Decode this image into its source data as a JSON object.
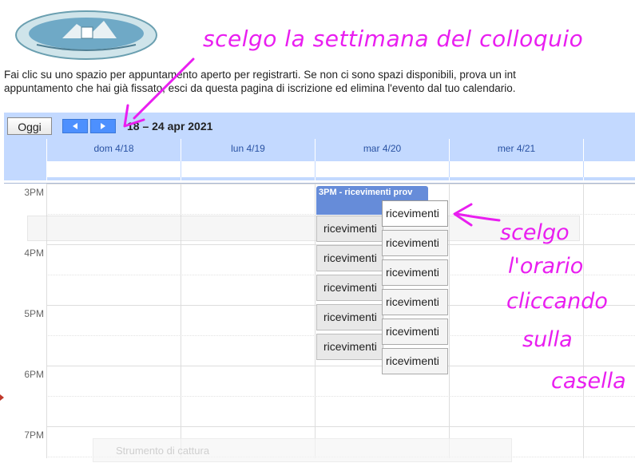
{
  "instructions": {
    "line1": "Fai clic su uno spazio per appuntamento aperto per registrarti. Se non ci sono spazi disponibili, prova un int",
    "line2": "appuntamento che hai già fissato, esci da questa pagina di iscrizione ed elimina l'evento dal tuo calendario."
  },
  "toolbar": {
    "today_label": "Oggi",
    "date_range": "18 – 24 apr 2021"
  },
  "days": [
    "dom 4/18",
    "lun 4/19",
    "mar 4/20",
    "mer 4/21"
  ],
  "hours": [
    "3PM",
    "4PM",
    "5PM",
    "6PM",
    "7PM"
  ],
  "event": {
    "title": "3PM - ricevimenti prov"
  },
  "slot_label": "ricevimenti",
  "faint_toolbar_label": "Strumento di cattura",
  "annotations": {
    "top": "scelgo la settimana del colloquio",
    "right": [
      "scelgo",
      "l'orario",
      "cliccando",
      "sulla",
      "casella"
    ]
  },
  "colors": {
    "header_bg": "#c3d9ff",
    "nav_button": "#4d90fe",
    "event_bg": "#668cd9",
    "annotation": "#e91ef0"
  }
}
